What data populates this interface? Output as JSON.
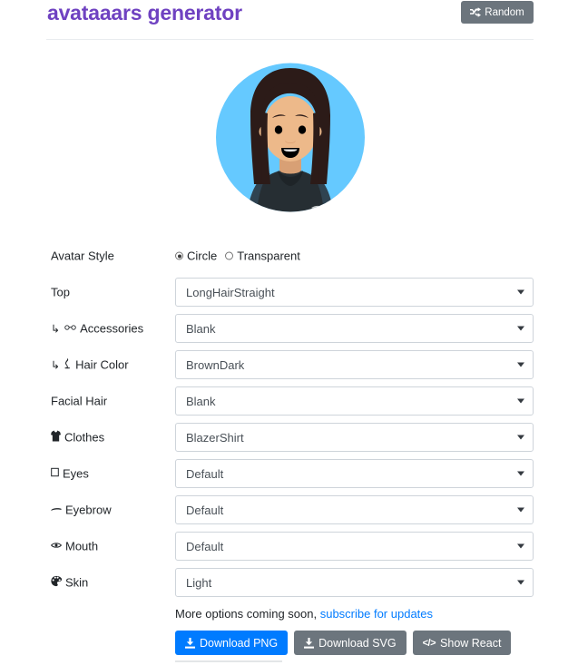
{
  "header": {
    "title": "avataaars generator",
    "random_button": {
      "label": "Random",
      "icon": "shuffle-icon",
      "bg": "#6c757d"
    },
    "title_color": "#6f42c1"
  },
  "avatar": {
    "style": "Circle",
    "circle_bg": "#65C9FF",
    "skin_color": "#EDB98A",
    "hair_color": "#2C1B18",
    "clothes_color": "#262E33",
    "clothes_accent": "#2F4351",
    "mouth_color": "#000000",
    "eye_color": "#000000"
  },
  "form": {
    "rows": [
      {
        "label": "Avatar Style",
        "icon": "",
        "sub": false,
        "control": "radio",
        "options": [
          "Circle",
          "Transparent"
        ],
        "selected": "Circle"
      },
      {
        "label": "Top",
        "icon": "",
        "sub": false,
        "control": "select",
        "value": "LongHairStraight"
      },
      {
        "label": "Accessories",
        "icon": "glasses-icon",
        "icon_glyph": "ᴴᴴ",
        "sub": true,
        "control": "select",
        "value": "Blank"
      },
      {
        "label": "Hair Color",
        "icon": "hair-color-icon",
        "icon_glyph": "⑂",
        "sub": true,
        "control": "select",
        "value": "BrownDark"
      },
      {
        "label": "Facial Hair",
        "icon": "",
        "sub": false,
        "control": "select",
        "value": "Blank"
      },
      {
        "label": "Clothes",
        "icon": "shirt-icon",
        "icon_glyph": "ὅ5",
        "sub": false,
        "control": "select",
        "value": "BlazerShirt"
      },
      {
        "label": "Eyes",
        "icon": "eyes-icon",
        "icon_glyph": "□",
        "sub": false,
        "control": "select",
        "value": "Default"
      },
      {
        "label": "Eyebrow",
        "icon": "eyebrow-icon",
        "icon_glyph": "▬",
        "sub": false,
        "control": "select",
        "value": "Default"
      },
      {
        "label": "Mouth",
        "icon": "mouth-icon",
        "icon_glyph": "❀",
        "sub": false,
        "control": "select",
        "value": "Default"
      },
      {
        "label": "Skin",
        "icon": "palette-icon",
        "icon_glyph": "❁",
        "sub": false,
        "control": "select",
        "value": "Light"
      }
    ],
    "sub_arrow": "↳"
  },
  "footer": {
    "more_options_text": "More options coming soon,",
    "subscribe_link": "subscribe for updates",
    "buttons": [
      {
        "label": "Download PNG",
        "icon": "download-icon",
        "style": "primary",
        "bg": "#007bff"
      },
      {
        "label": "Download SVG",
        "icon": "download-icon",
        "style": "secondary",
        "bg": "#6c757d"
      },
      {
        "label": "Show React",
        "icon": "code-icon",
        "style": "secondary",
        "bg": "#6c757d"
      }
    ]
  }
}
